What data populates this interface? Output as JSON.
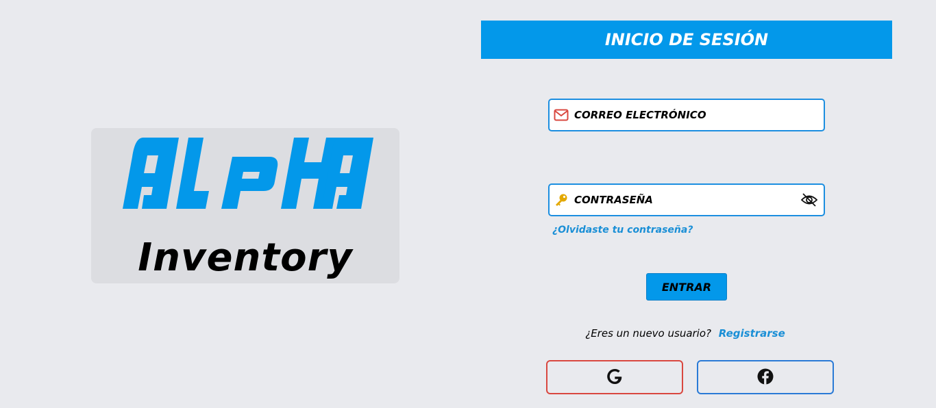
{
  "logo": {
    "wordmark": "ALPHA",
    "subtitle": "Inventory",
    "wordmark_color": "#0398ea"
  },
  "login": {
    "title": "INICIO DE SESIÓN",
    "email_placeholder": "CORREO ELECTRÓNICO",
    "email_value": "",
    "email_icon": "envelope-icon",
    "password_placeholder": "CONTRASEÑA",
    "password_value": "",
    "password_icon": "key-icon",
    "toggle_visibility_icon": "eye-slash-icon",
    "forgot_password": "¿Olvidaste tu contraseña?",
    "submit_label": "ENTRAR",
    "register_prompt": "¿Eres un nuevo usuario?",
    "register_link": "Registrarse",
    "social": [
      {
        "provider": "google",
        "icon": "google-icon",
        "border_color": "#d9473f"
      },
      {
        "provider": "facebook",
        "icon": "facebook-icon",
        "border_color": "#2a7ad6"
      }
    ]
  },
  "colors": {
    "background": "#e9eaee",
    "accent": "#0398ea",
    "link": "#1a8fd6",
    "envelope_icon": "#d9473f",
    "key_icon": "#e3a800"
  }
}
